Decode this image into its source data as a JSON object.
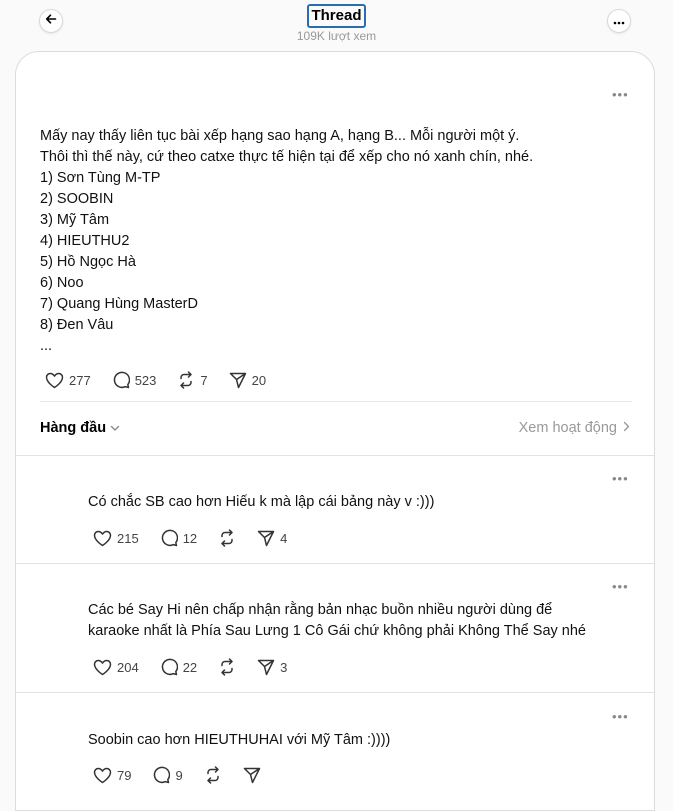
{
  "header": {
    "title": "Thread",
    "views": "109K lượt xem"
  },
  "post": {
    "lines": [
      "Mấy nay thấy liên tục bài xếp hạng sao hạng A, hạng B... Mỗi người một ý.",
      "Thôi thì thế này, cứ theo catxe thực tế hiện tại để xếp cho nó xanh chín, nhé.",
      "1) Sơn Tùng M-TP",
      "2) SOOBIN",
      "3) Mỹ Tâm",
      "4) HIEUTHU2",
      "5) Hồ Ngọc Hà",
      "6) Noo",
      "7) Quang Hùng MasterD",
      "8) Đen Vâu",
      "..."
    ],
    "likes": "277",
    "comments": "523",
    "reposts": "7",
    "shares": "20"
  },
  "sort": {
    "label": "Hàng đầu",
    "activity_label": "Xem hoạt động"
  },
  "replies": [
    {
      "lines": [
        "Có chắc SB cao hơn Hiếu k mà lập cái bảng này v :)))"
      ],
      "likes": "215",
      "comments": "12",
      "reposts": "",
      "shares": "4"
    },
    {
      "lines": [
        "Các bé Say Hi nên chấp nhận rằng bản nhạc buồn nhiều người dùng để",
        "karaoke nhất là Phía Sau Lưng 1 Cô Gái chứ không phải Không Thể Say nhé"
      ],
      "likes": "204",
      "comments": "22",
      "reposts": "",
      "shares": "3"
    },
    {
      "lines": [
        "Soobin cao hơn HIEUTHUHAI với Mỹ Tâm :))))"
      ],
      "likes": "79",
      "comments": "9",
      "reposts": "",
      "shares": ""
    }
  ],
  "icons": {
    "back": "arrow-left-icon",
    "more": "more-horizontal-icon",
    "like": "heart-icon",
    "comment": "comment-icon",
    "repost": "repost-icon",
    "share": "send-icon",
    "chevron_down": "chevron-down-icon",
    "chevron_right": "chevron-right-icon"
  },
  "colors": {
    "focus_outline": "#2b6cb0",
    "muted_text": "#999999"
  }
}
